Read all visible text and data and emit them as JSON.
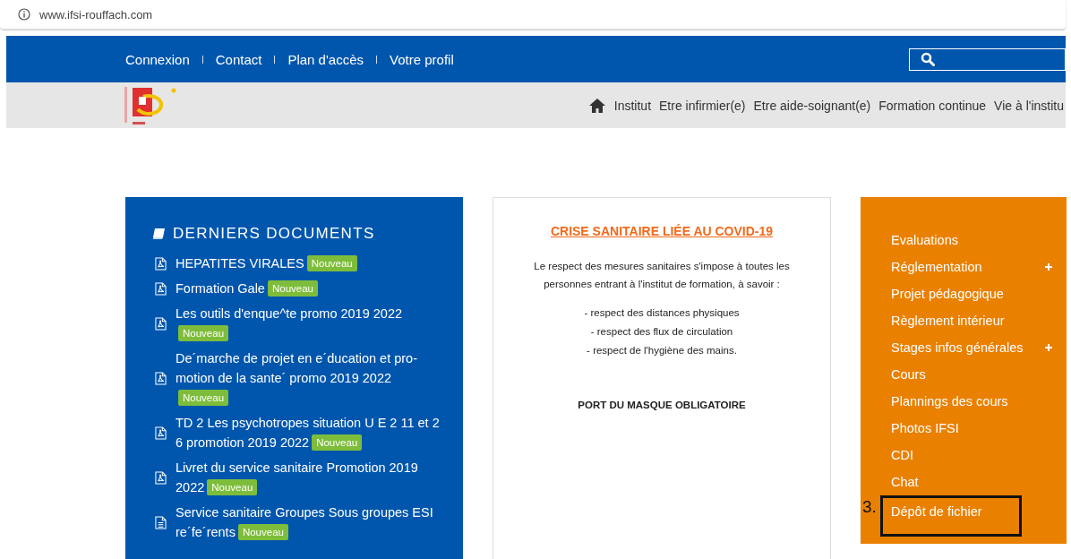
{
  "browser": {
    "url": "www.ifsi-rouffach.com"
  },
  "top_bar": {
    "links": [
      "Connexion",
      "Contact",
      "Plan d'accès",
      "Votre profil"
    ]
  },
  "main_nav": {
    "items": [
      "Institut",
      "Etre infirmier(e)",
      "Etre aide-soignant(e)",
      "Formation continue",
      "Vie à l'institu"
    ]
  },
  "documents": {
    "title": "DERNIERS DOCUMENTS",
    "items": [
      {
        "kind": "pdf",
        "title": "HEPATITES VIRALES",
        "badge": "Nouveau"
      },
      {
        "kind": "pdf",
        "title": "Formation Gale",
        "badge": "Nouveau"
      },
      {
        "kind": "pdf",
        "title": "Les outils d'enque^te promo 2019 2022",
        "badge": "Nouveau"
      },
      {
        "kind": "pdf",
        "title": "De´marche de projet en e´ducation et pro-motion de la sante´ promo 2019 2022",
        "badge": "Nouveau"
      },
      {
        "kind": "pdf",
        "title": "TD 2 Les psychotropes situation U E 2 11 et 2 6 promotion 2019 2022",
        "badge": "Nouveau"
      },
      {
        "kind": "pdf",
        "title": "Livret du service sanitaire Promotion 2019 2022",
        "badge": "Nouveau"
      },
      {
        "kind": "text",
        "title": "Service sanitaire Groupes Sous groupes ESI re´fe´rents",
        "badge": "Nouveau"
      }
    ]
  },
  "notice": {
    "title": "CRISE SANITAIRE LIÉE AU COVID-19",
    "intro": "Le respect des mesures sanitaires s'impose à toutes les personnes entrant à l'institut de formation, à savoir :",
    "measures": [
      "- respect des distances physiques",
      "- respect des flux de circulation",
      "- respect de l'hygiène des mains."
    ],
    "footer": "PORT DU MASQUE OBLIGATOIRE"
  },
  "side_menu": {
    "annotation": "3.",
    "items": [
      {
        "label": "Evaluations",
        "has_submenu": false,
        "highlighted": false
      },
      {
        "label": "Réglementation",
        "has_submenu": true,
        "highlighted": false
      },
      {
        "label": "Projet pédagogique",
        "has_submenu": false,
        "highlighted": false
      },
      {
        "label": "Règlement intérieur",
        "has_submenu": false,
        "highlighted": false
      },
      {
        "label": "Stages infos générales",
        "has_submenu": true,
        "highlighted": false
      },
      {
        "label": "Cours",
        "has_submenu": false,
        "highlighted": false
      },
      {
        "label": "Plannings des cours",
        "has_submenu": false,
        "highlighted": false
      },
      {
        "label": "Photos IFSI",
        "has_submenu": false,
        "highlighted": false
      },
      {
        "label": "CDI",
        "has_submenu": false,
        "highlighted": false
      },
      {
        "label": "Chat",
        "has_submenu": false,
        "highlighted": false
      },
      {
        "label": "Dépôt de fichier",
        "has_submenu": false,
        "highlighted": true
      }
    ]
  }
}
